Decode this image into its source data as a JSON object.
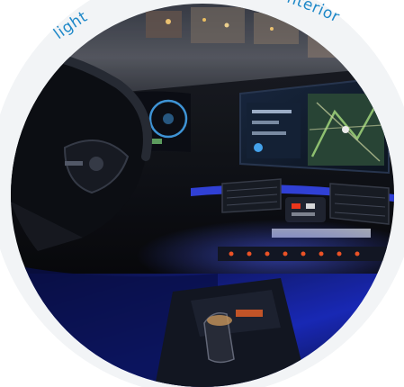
{
  "label": {
    "left": "light",
    "right": "nterior",
    "color": "#1e88c8"
  },
  "colors": {
    "ambient_blue": "#2a3cff",
    "screen_blue": "#2c6fb0",
    "nav_green": "#9bd07a",
    "button_red": "#ff3b1f",
    "dash_dark": "#101318",
    "backdrop": "#f2f4f6"
  },
  "icons": [
    "steering-wheel-icon",
    "gear-selector-icon",
    "navigation-map-icon"
  ]
}
